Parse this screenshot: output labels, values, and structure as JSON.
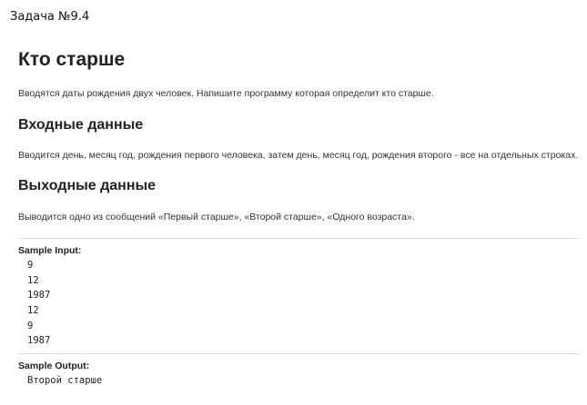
{
  "task_label": "Задача №9.4",
  "title": "Кто старше",
  "description": "Вводятся даты рождения двух человек. Напишите программу которая определит кто старше.",
  "input_section": {
    "heading": "Входные данные",
    "text": "Вводится день, месяц год, рождения первого человека, затем день, месяц год, рождения второго - все на отдельных строках."
  },
  "output_section": {
    "heading": "Выходные данные",
    "text": "Выводится одно из сообщений «Первый старше», «Второй старше», «Одного возраста»."
  },
  "sample_input": {
    "label": "Sample Input:",
    "lines": [
      "9",
      "12",
      "1987",
      "12",
      "9",
      "1987"
    ]
  },
  "sample_output": {
    "label": "Sample Output:",
    "lines": [
      "Второй старше"
    ]
  }
}
